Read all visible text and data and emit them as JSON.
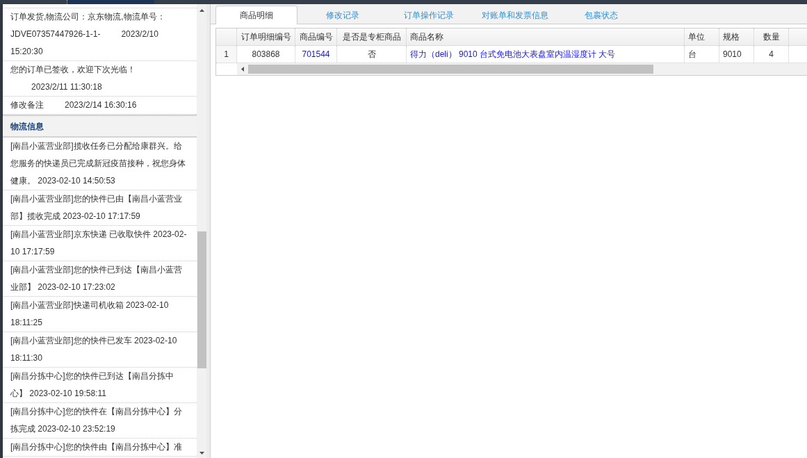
{
  "order_log": [
    {
      "text": "订单发货,物流公司：京东物流,物流单号：JDVE07357447926-1-1-",
      "time": "2023/2/10 15:20:30"
    },
    {
      "text": "您的订单已签收，欢迎下次光临！",
      "time": "2023/2/11 11:30:18"
    },
    {
      "text": "修改备注",
      "time": "2023/2/14 16:30:16"
    }
  ],
  "logistics": {
    "title": "物流信息",
    "entries": [
      "[南昌小蓝营业部]揽收任务已分配给康群兴。给您服务的快递员已完成新冠疫苗接种，祝您身体健康。 2023-02-10 14:50:53",
      "[南昌小蓝营业部]您的快件已由【南昌小蓝营业部】揽收完成 2023-02-10 17:17:59",
      "[南昌小蓝营业部]京东快递 已收取快件 2023-02-10 17:17:59",
      "[南昌小蓝营业部]您的快件已到达【南昌小蓝营业部】 2023-02-10 17:23:02",
      "[南昌小蓝营业部]快递司机收箱 2023-02-10 18:11:25",
      "[南昌小蓝营业部]您的快件已发车 2023-02-10 18:11:30",
      "[南昌分拣中心]您的快件已到达【南昌分拣中心】 2023-02-10 19:58:11",
      "[南昌分拣中心]您的快件在【南昌分拣中心】分拣完成 2023-02-10 23:52:19",
      "[南昌分拣中心]您的快件由【南昌分拣中心】准"
    ]
  },
  "tabs": [
    {
      "label": "商品明细",
      "selected": true
    },
    {
      "label": "修改记录",
      "selected": false
    },
    {
      "label": "订单操作记录",
      "selected": false
    },
    {
      "label": "对账单和发票信息",
      "selected": false
    },
    {
      "label": "包裹状态",
      "selected": false
    }
  ],
  "table": {
    "columns": [
      "订单明细编号",
      "商品编号",
      "是否是专柜商品",
      "商品名称",
      "单位",
      "规格",
      "数量"
    ],
    "rows": [
      {
        "number": "1",
        "cells": [
          "803868",
          "701544",
          "否",
          "得力（deli） 9010 台式免电池大表盘室内温湿度计 大号",
          "台",
          "9010",
          "4"
        ]
      }
    ]
  }
}
